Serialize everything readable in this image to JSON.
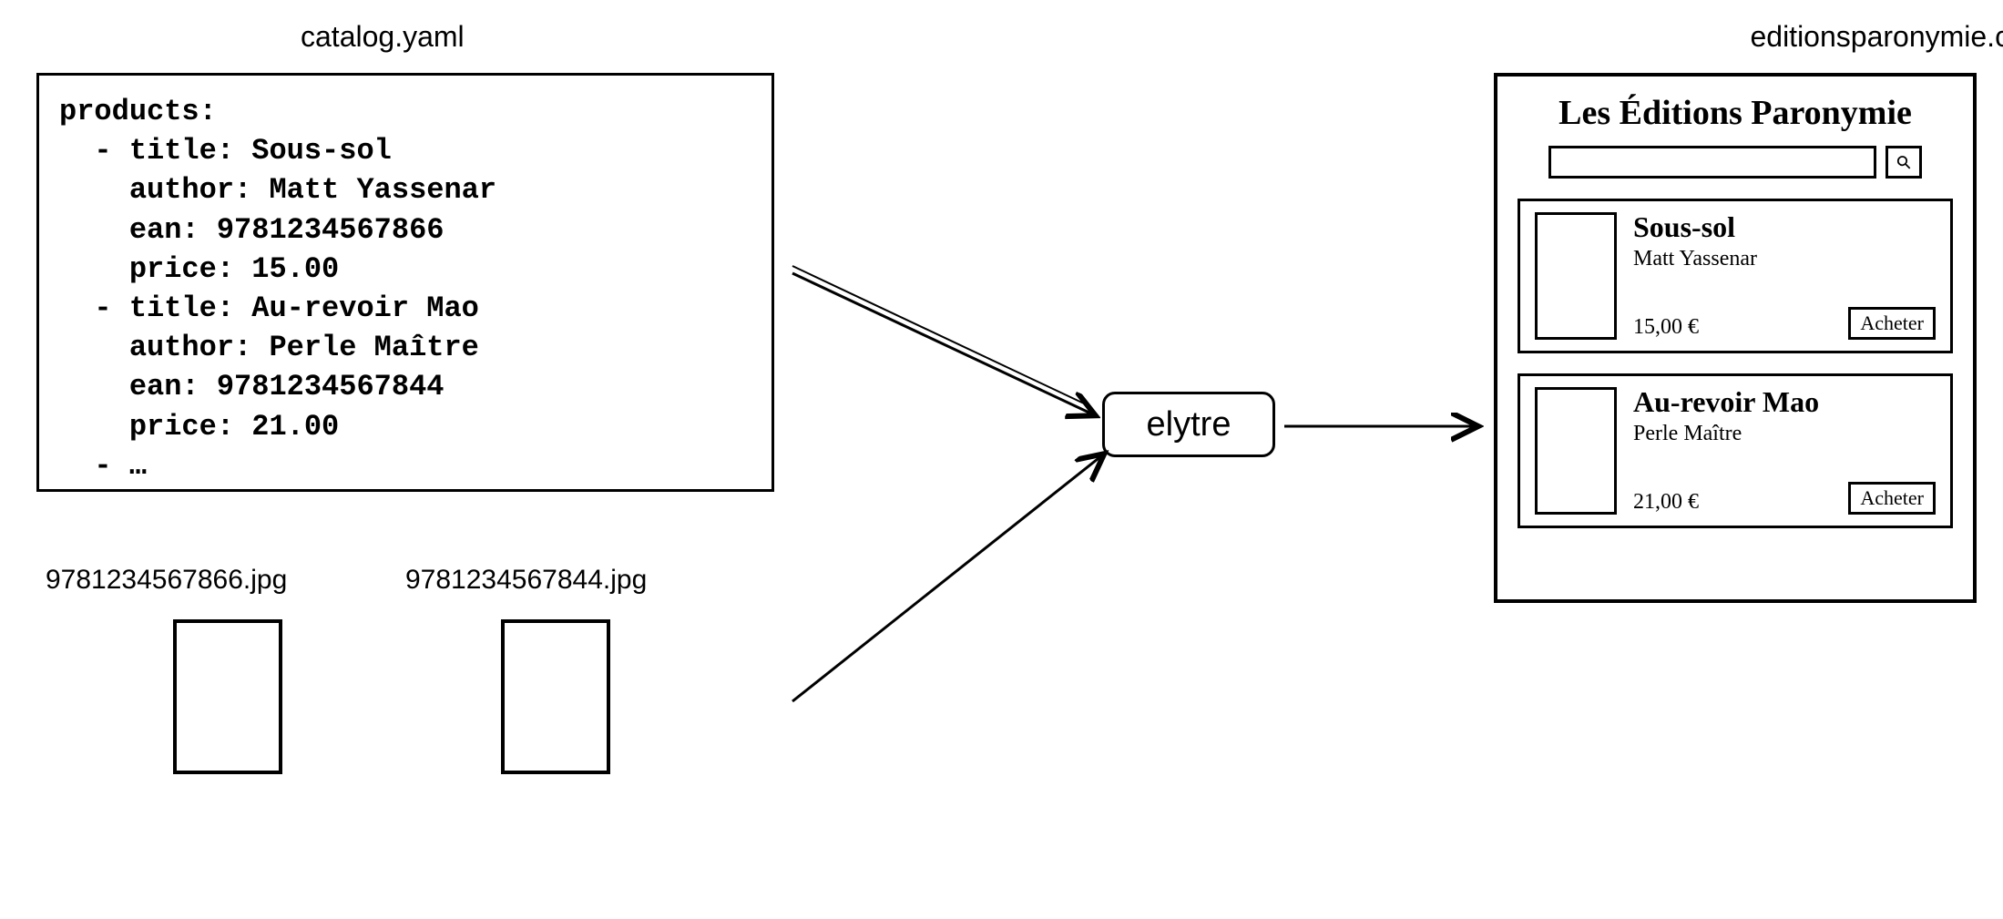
{
  "yaml": {
    "title": "catalog.yaml",
    "content": "products:\n  - title: Sous-sol\n    author: Matt Yassenar\n    ean: 9781234567866\n    price: 15.00\n  - title: Au-revoir Mao\n    author: Perle Maître\n    ean: 9781234567844\n    price: 21.00\n  - …"
  },
  "files": {
    "f1_label": "9781234567866.jpg",
    "f2_label": "9781234567844.jpg"
  },
  "center": {
    "label": "elytre"
  },
  "site": {
    "domain": "editionsparonymie.com",
    "heading": "Les Éditions Paronymie",
    "search_icon_glyph": "⚲",
    "buy_label": "Acheter",
    "products": [
      {
        "title": "Sous-sol",
        "author": "Matt Yassenar",
        "price": "15,00 €"
      },
      {
        "title": "Au-revoir Mao",
        "author": "Perle Maître",
        "price": "21,00 €"
      }
    ]
  }
}
